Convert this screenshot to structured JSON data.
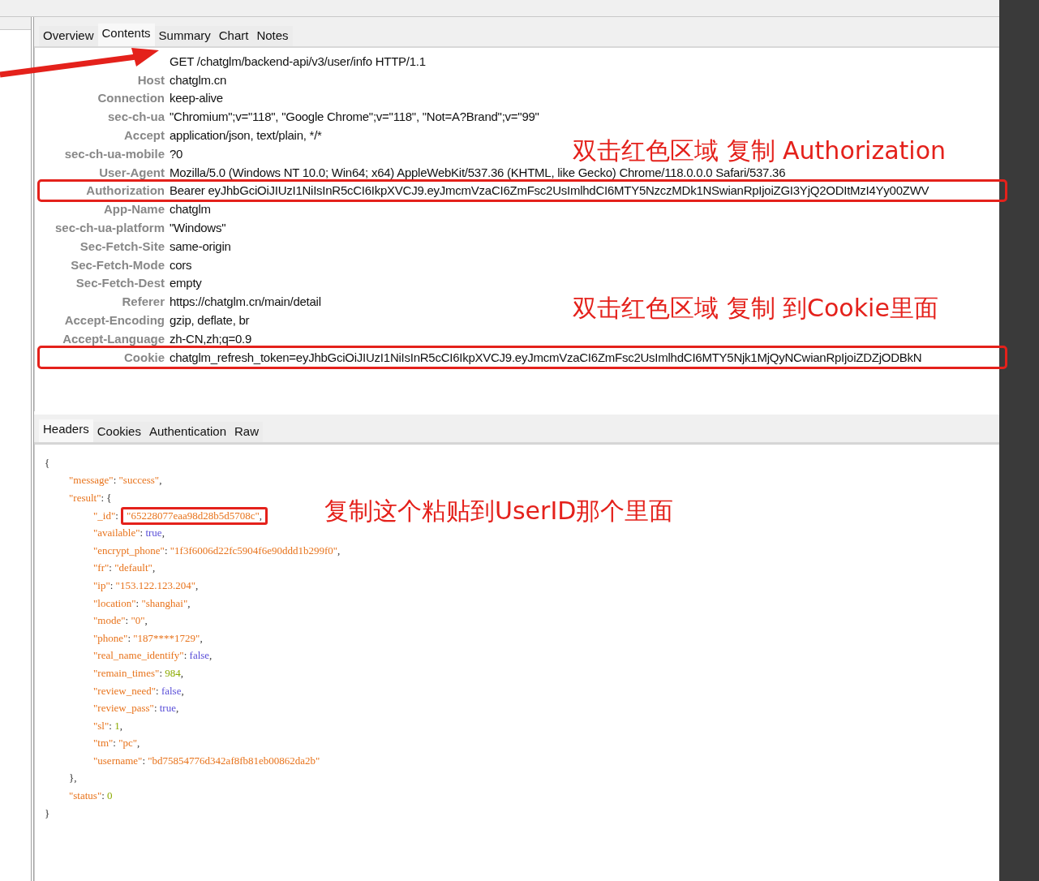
{
  "request_tabs": [
    {
      "label": "Overview",
      "selected": false
    },
    {
      "label": "Contents",
      "selected": true
    },
    {
      "label": "Summary",
      "selected": false
    },
    {
      "label": "Chart",
      "selected": false
    },
    {
      "label": "Notes",
      "selected": false
    }
  ],
  "request_headers": [
    {
      "value": "GET /chatglm/backend-api/v3/user/info HTTP/1.1",
      "highlighted": false
    },
    {
      "name": "Host",
      "value": "chatglm.cn",
      "highlighted": false
    },
    {
      "name": "Connection",
      "value": "keep-alive",
      "highlighted": false
    },
    {
      "name": "sec-ch-ua",
      "value": "\"Chromium\";v=\"118\", \"Google Chrome\";v=\"118\", \"Not=A?Brand\";v=\"99\"",
      "highlighted": false
    },
    {
      "name": "Accept",
      "value": "application/json, text/plain, */*",
      "highlighted": false
    },
    {
      "name": "sec-ch-ua-mobile",
      "value": "?0",
      "highlighted": false
    },
    {
      "name": "User-Agent",
      "value": "Mozilla/5.0 (Windows NT 10.0; Win64; x64) AppleWebKit/537.36 (KHTML, like Gecko) Chrome/118.0.0.0 Safari/537.36",
      "highlighted": false
    },
    {
      "name": "Authorization",
      "value": "Bearer eyJhbGciOiJIUzI1NiIsInR5cCI6IkpXVCJ9.eyJmcmVzaCI6ZmFsc2UsImlhdCI6MTY5NzczMDk1NSwianRpIjoiZGI3YjQ2ODItMzI4Yy00ZWV",
      "highlighted": true
    },
    {
      "name": "App-Name",
      "value": "chatglm",
      "highlighted": false
    },
    {
      "name": "sec-ch-ua-platform",
      "value": "\"Windows\"",
      "highlighted": false
    },
    {
      "name": "Sec-Fetch-Site",
      "value": "same-origin",
      "highlighted": false
    },
    {
      "name": "Sec-Fetch-Mode",
      "value": "cors",
      "highlighted": false
    },
    {
      "name": "Sec-Fetch-Dest",
      "value": "empty",
      "highlighted": false
    },
    {
      "name": "Referer",
      "value": "https://chatglm.cn/main/detail",
      "highlighted": false
    },
    {
      "name": "Accept-Encoding",
      "value": "gzip, deflate, br",
      "highlighted": false
    },
    {
      "name": "Accept-Language",
      "value": "zh-CN,zh;q=0.9",
      "highlighted": false
    },
    {
      "name": "Cookie",
      "value": "chatglm_refresh_token=eyJhbGciOiJIUzI1NiIsInR5cCI6IkpXVCJ9.eyJmcmVzaCI6ZmFsc2UsImlhdCI6MTY5Njk1MjQyNCwianRpIjoiZDZjODBkN",
      "highlighted": true
    }
  ],
  "annotations": [
    {
      "kind": "authorization",
      "text": "双击红色区域  复制 Authorization"
    },
    {
      "kind": "cookie",
      "text": "双击红色区域 复制 到Cookie里面"
    },
    {
      "kind": "userid",
      "text": "复制这个粘贴到UserID那个里面"
    }
  ],
  "response_tabs": [
    {
      "label": "Headers",
      "selected": true
    },
    {
      "label": "Cookies",
      "selected": false
    },
    {
      "label": "Authentication",
      "selected": false
    },
    {
      "label": "Raw",
      "selected": false
    }
  ],
  "response_body": [
    {
      "tokens": [
        {
          "text": "{",
          "kind": "punct"
        }
      ],
      "children": [
        {
          "tokens": [
            {
              "text": "\"message\"",
              "kind": "key"
            },
            {
              "text": ": ",
              "kind": "punct"
            },
            {
              "text": "\"success\"",
              "kind": "string"
            },
            {
              "text": ",",
              "kind": "punct"
            }
          ]
        },
        {
          "tokens": [
            {
              "text": "\"result\"",
              "kind": "key"
            },
            {
              "text": ": {",
              "kind": "punct"
            }
          ],
          "children": [
            {
              "tokens": [
                {
                  "text": "\"_id\"",
                  "kind": "key"
                },
                {
                  "text": ": ",
                  "kind": "punct"
                },
                {
                  "text": "\"65228077eaa98d28b5d5708c\"",
                  "kind": "string",
                  "highlighted": true
                },
                {
                  "text": ",",
                  "kind": "punct",
                  "highlighted": true
                }
              ]
            },
            {
              "tokens": [
                {
                  "text": "\"available\"",
                  "kind": "key"
                },
                {
                  "text": ": ",
                  "kind": "punct"
                },
                {
                  "text": "true",
                  "kind": "bool"
                },
                {
                  "text": ",",
                  "kind": "punct"
                }
              ]
            },
            {
              "tokens": [
                {
                  "text": "\"encrypt_phone\"",
                  "kind": "key"
                },
                {
                  "text": ": ",
                  "kind": "punct"
                },
                {
                  "text": "\"1f3f6006d22fc5904f6e90ddd1b299f0\"",
                  "kind": "string"
                },
                {
                  "text": ",",
                  "kind": "punct"
                }
              ]
            },
            {
              "tokens": [
                {
                  "text": "\"fr\"",
                  "kind": "key"
                },
                {
                  "text": ": ",
                  "kind": "punct"
                },
                {
                  "text": "\"default\"",
                  "kind": "string"
                },
                {
                  "text": ",",
                  "kind": "punct"
                }
              ]
            },
            {
              "tokens": [
                {
                  "text": "\"ip\"",
                  "kind": "key"
                },
                {
                  "text": ": ",
                  "kind": "punct"
                },
                {
                  "text": "\"153.122.123.204\"",
                  "kind": "string"
                },
                {
                  "text": ",",
                  "kind": "punct"
                }
              ]
            },
            {
              "tokens": [
                {
                  "text": "\"location\"",
                  "kind": "key"
                },
                {
                  "text": ": ",
                  "kind": "punct"
                },
                {
                  "text": "\"shanghai\"",
                  "kind": "string"
                },
                {
                  "text": ",",
                  "kind": "punct"
                }
              ]
            },
            {
              "tokens": [
                {
                  "text": "\"mode\"",
                  "kind": "key"
                },
                {
                  "text": ": ",
                  "kind": "punct"
                },
                {
                  "text": "\"0\"",
                  "kind": "string"
                },
                {
                  "text": ",",
                  "kind": "punct"
                }
              ]
            },
            {
              "tokens": [
                {
                  "text": "\"phone\"",
                  "kind": "key"
                },
                {
                  "text": ": ",
                  "kind": "punct"
                },
                {
                  "text": "\"187****1729\"",
                  "kind": "string"
                },
                {
                  "text": ",",
                  "kind": "punct"
                }
              ]
            },
            {
              "tokens": [
                {
                  "text": "\"real_name_identify\"",
                  "kind": "key"
                },
                {
                  "text": ": ",
                  "kind": "punct"
                },
                {
                  "text": "false",
                  "kind": "bool"
                },
                {
                  "text": ",",
                  "kind": "punct"
                }
              ]
            },
            {
              "tokens": [
                {
                  "text": "\"remain_times\"",
                  "kind": "key"
                },
                {
                  "text": ": ",
                  "kind": "punct"
                },
                {
                  "text": "984",
                  "kind": "number"
                },
                {
                  "text": ",",
                  "kind": "punct"
                }
              ]
            },
            {
              "tokens": [
                {
                  "text": "\"review_need\"",
                  "kind": "key"
                },
                {
                  "text": ": ",
                  "kind": "punct"
                },
                {
                  "text": "false",
                  "kind": "bool"
                },
                {
                  "text": ",",
                  "kind": "punct"
                }
              ]
            },
            {
              "tokens": [
                {
                  "text": "\"review_pass\"",
                  "kind": "key"
                },
                {
                  "text": ": ",
                  "kind": "punct"
                },
                {
                  "text": "true",
                  "kind": "bool"
                },
                {
                  "text": ",",
                  "kind": "punct"
                }
              ]
            },
            {
              "tokens": [
                {
                  "text": "\"sl\"",
                  "kind": "key"
                },
                {
                  "text": ": ",
                  "kind": "punct"
                },
                {
                  "text": "1",
                  "kind": "number"
                },
                {
                  "text": ",",
                  "kind": "punct"
                }
              ]
            },
            {
              "tokens": [
                {
                  "text": "\"tm\"",
                  "kind": "key"
                },
                {
                  "text": ": ",
                  "kind": "punct"
                },
                {
                  "text": "\"pc\"",
                  "kind": "string"
                },
                {
                  "text": ",",
                  "kind": "punct"
                }
              ]
            },
            {
              "tokens": [
                {
                  "text": "\"username\"",
                  "kind": "key"
                },
                {
                  "text": ": ",
                  "kind": "punct"
                },
                {
                  "text": "\"bd75854776d342af8fb81eb00862da2b\"",
                  "kind": "string"
                }
              ]
            }
          ],
          "close": "},"
        },
        {
          "tokens": [
            {
              "text": "\"status\"",
              "kind": "key"
            },
            {
              "text": ": ",
              "kind": "punct"
            },
            {
              "text": "0",
              "kind": "number"
            }
          ]
        }
      ],
      "close": "}"
    }
  ]
}
